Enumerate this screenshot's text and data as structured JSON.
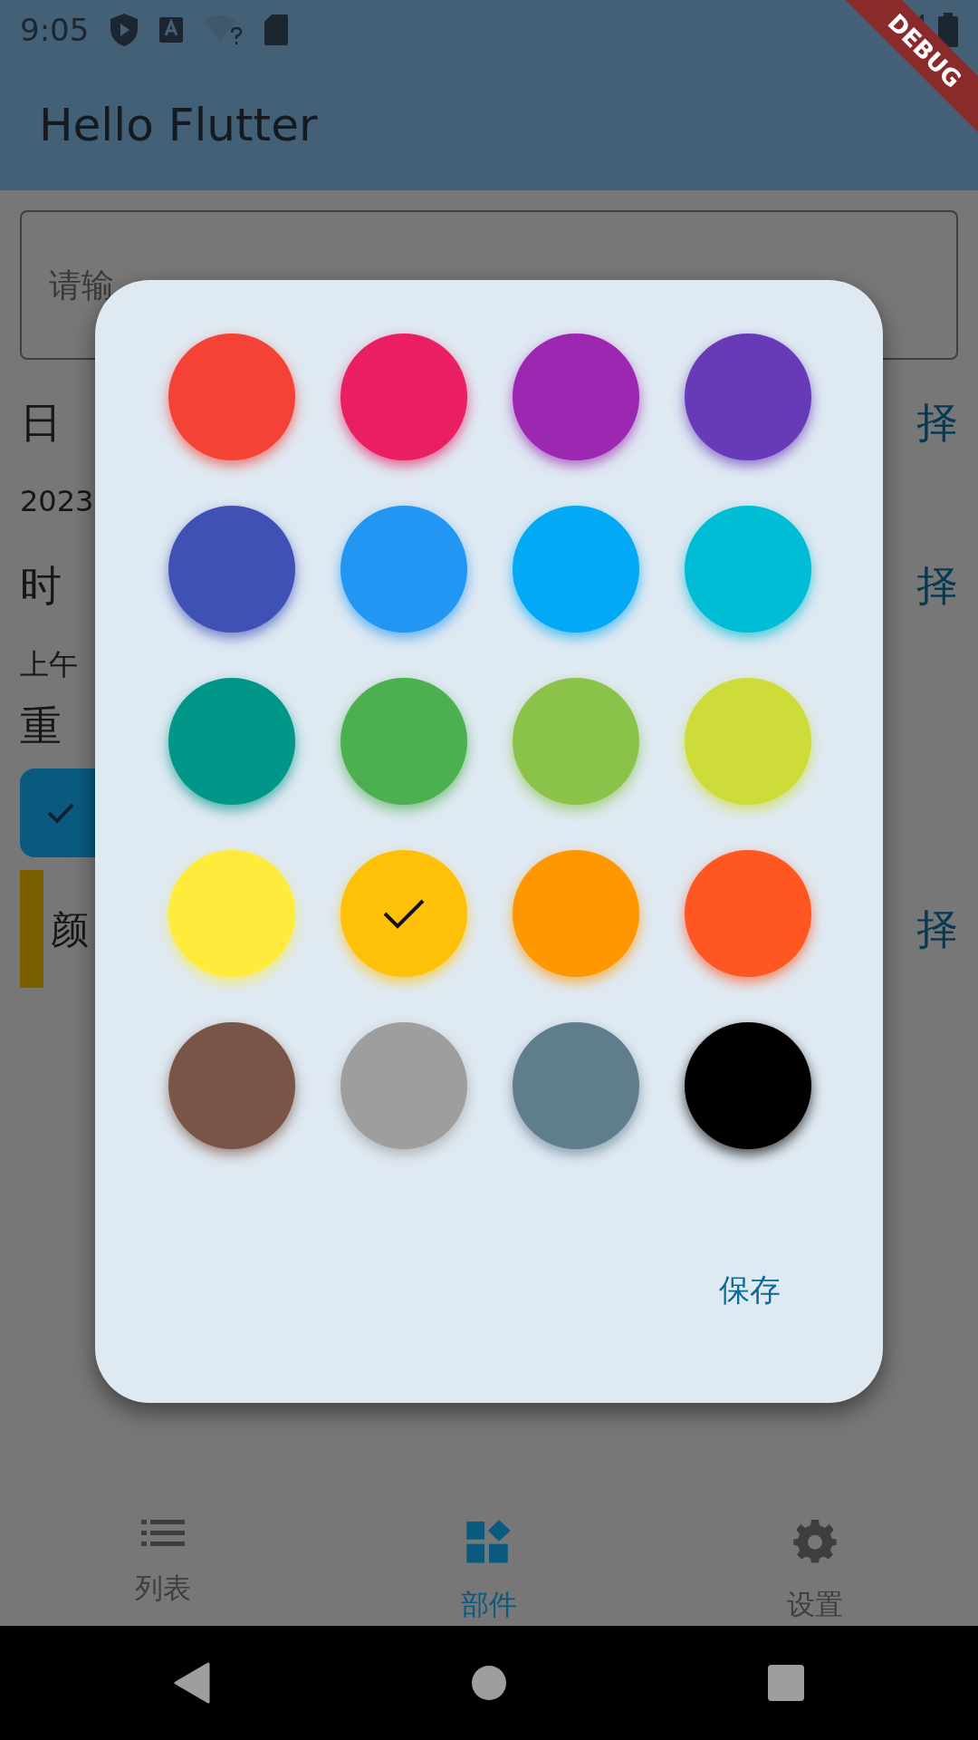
{
  "status_bar": {
    "time": "9:05"
  },
  "debug_banner": "DEBUG",
  "app_bar": {
    "title": "Hello Flutter"
  },
  "text_field": {
    "placeholder": "请输"
  },
  "rows": [
    {
      "kind": "label",
      "text": "日",
      "action": "择"
    },
    {
      "kind": "value",
      "text": "2023"
    },
    {
      "kind": "label",
      "text": "时",
      "action": "择"
    },
    {
      "kind": "value",
      "text": "上午"
    },
    {
      "kind": "heading",
      "text": "重"
    },
    {
      "kind": "chip",
      "selected": true
    },
    {
      "kind": "color",
      "color": "#7a5f00",
      "text": "颜",
      "action": "择"
    }
  ],
  "dialog": {
    "colors": [
      {
        "color": "#f44336",
        "selected": false
      },
      {
        "color": "#e91e63",
        "selected": false
      },
      {
        "color": "#9c27b0",
        "selected": false
      },
      {
        "color": "#673ab7",
        "selected": false
      },
      {
        "color": "#3f51b5",
        "selected": false
      },
      {
        "color": "#2196f3",
        "selected": false
      },
      {
        "color": "#03a9f4",
        "selected": false
      },
      {
        "color": "#00bcd4",
        "selected": false
      },
      {
        "color": "#009688",
        "selected": false
      },
      {
        "color": "#4caf50",
        "selected": false
      },
      {
        "color": "#8bc34a",
        "selected": false
      },
      {
        "color": "#cddc39",
        "selected": false
      },
      {
        "color": "#ffeb3b",
        "selected": false
      },
      {
        "color": "#ffc107",
        "selected": true
      },
      {
        "color": "#ff9800",
        "selected": false
      },
      {
        "color": "#ff5722",
        "selected": false
      },
      {
        "color": "#795548",
        "selected": false
      },
      {
        "color": "#9e9e9e",
        "selected": false
      },
      {
        "color": "#607d8b",
        "selected": false
      },
      {
        "color": "#000000",
        "selected": false
      }
    ],
    "save_button": "保存"
  },
  "bottom_nav": [
    {
      "label": "列表",
      "selected": false
    },
    {
      "label": "部件",
      "selected": true
    },
    {
      "label": "设置",
      "selected": false
    }
  ]
}
